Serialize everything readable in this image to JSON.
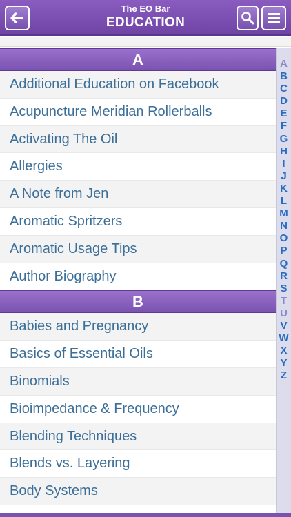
{
  "header": {
    "app_name": "The EO Bar",
    "title": "EDUCATION",
    "back_icon": "arrow-left-icon",
    "search_icon": "search-icon",
    "menu_icon": "hamburger-menu-icon"
  },
  "colors": {
    "accent": "#7a52b0",
    "link": "#3c6f98",
    "index": "#2a6cbf"
  },
  "sections": [
    {
      "letter": "A",
      "items": [
        "Additional Education on Facebook",
        "Acupuncture Meridian Rollerballs",
        "Activating The Oil",
        "Allergies",
        "A Note from Jen",
        "Aromatic Spritzers",
        "Aromatic Usage Tips",
        "Author Biography"
      ]
    },
    {
      "letter": "B",
      "items": [
        "Babies and Pregnancy",
        "Basics of Essential Oils",
        "Binomials",
        "Bioimpedance & Frequency",
        "Blending Techniques",
        "Blends vs. Layering",
        "Body Systems"
      ]
    }
  ],
  "index_letters": [
    "A",
    "B",
    "C",
    "D",
    "E",
    "F",
    "G",
    "H",
    "I",
    "J",
    "K",
    "L",
    "M",
    "N",
    "O",
    "P",
    "Q",
    "R",
    "S",
    "T",
    "U",
    "V",
    "W",
    "X",
    "Y",
    "Z"
  ]
}
